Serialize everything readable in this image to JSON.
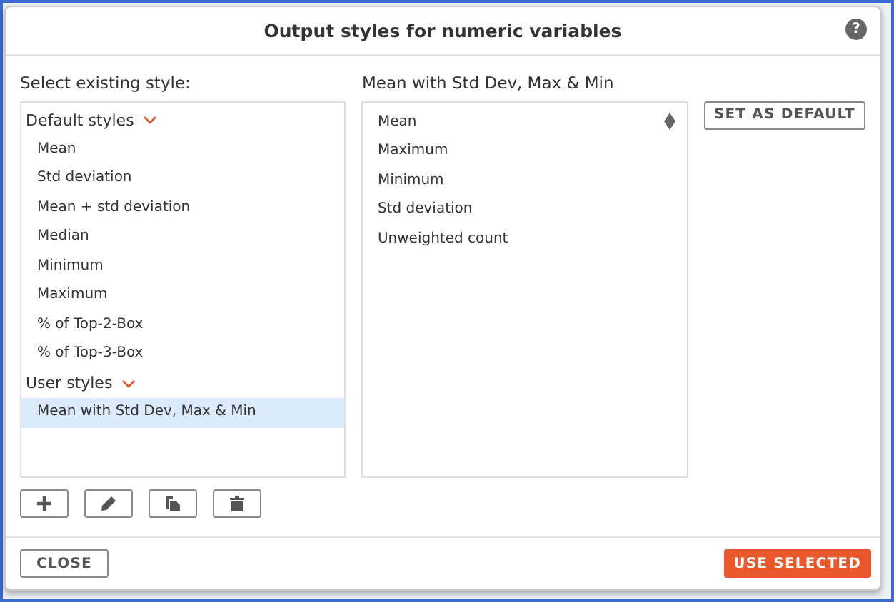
{
  "dialog": {
    "title": "Output styles for numeric variables",
    "help": "?"
  },
  "left": {
    "label": "Select existing style:",
    "groups": [
      {
        "name": "Default styles",
        "expanded": true,
        "items": [
          {
            "label": "Mean",
            "selected": false
          },
          {
            "label": "Std deviation",
            "selected": false
          },
          {
            "label": "Mean + std deviation",
            "selected": false
          },
          {
            "label": "Median",
            "selected": false
          },
          {
            "label": "Minimum",
            "selected": false
          },
          {
            "label": "Maximum",
            "selected": false
          },
          {
            "label": "% of Top-2-Box",
            "selected": false
          },
          {
            "label": "% of Top-3-Box",
            "selected": false
          }
        ]
      },
      {
        "name": "User styles",
        "expanded": true,
        "items": [
          {
            "label": "Mean with Std Dev, Max & Min",
            "selected": true
          }
        ]
      }
    ]
  },
  "right": {
    "label": "Mean with Std Dev, Max & Min",
    "items": [
      {
        "label": "Mean",
        "hovered": true
      },
      {
        "label": "Maximum",
        "hovered": false
      },
      {
        "label": "Minimum",
        "hovered": false
      },
      {
        "label": "Std deviation",
        "hovered": false
      },
      {
        "label": "Unweighted count",
        "hovered": false
      }
    ]
  },
  "set_default_button": "SET AS DEFAULT",
  "tools": [
    {
      "kind": "add"
    },
    {
      "kind": "edit"
    },
    {
      "kind": "copy"
    },
    {
      "kind": "delete"
    }
  ],
  "footer": {
    "close": "CLOSE",
    "use": "USE SELECTED"
  }
}
